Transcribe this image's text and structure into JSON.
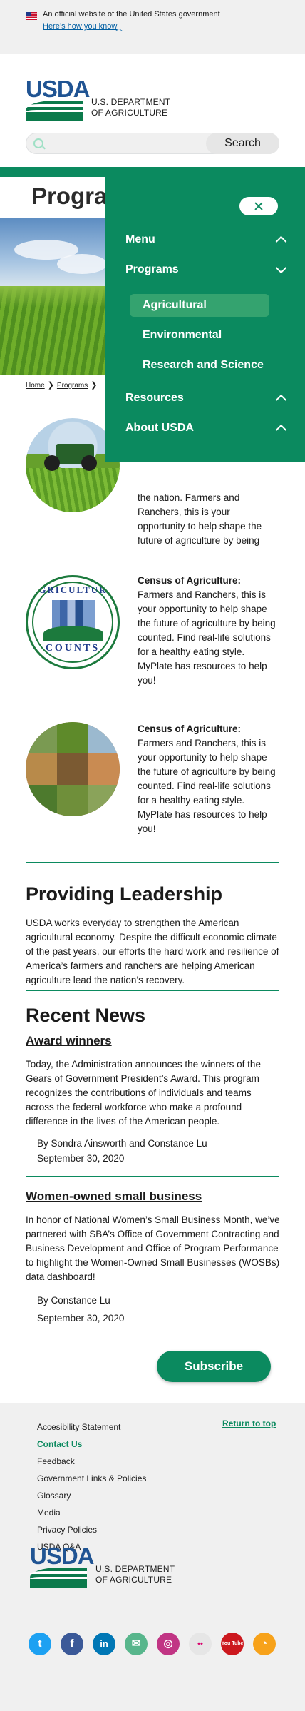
{
  "gov_banner": {
    "text": "An official website of the United States government",
    "link": "Here’s how you know"
  },
  "header": {
    "logo_usda": "USDA",
    "logo_line1": "U.S. DEPARTMENT",
    "logo_line2": "OF AGRICULTURE",
    "search_placeholder": "",
    "search_button": "Search"
  },
  "page": {
    "title": "Programs",
    "breadcrumb": [
      "Home",
      "Programs"
    ]
  },
  "cards": [
    {
      "title": "",
      "text": "the nation. Farmers and Ranchers, this is your opportunity to help shape the future of agriculture by being"
    },
    {
      "title": "Census of Agriculture:",
      "text": "Farmers and Ranchers, this is your opportunity to help shape the future of agriculture by being counted. Find real-life solutions for a healthy eating style. MyPlate has resources to help you!",
      "logo_top": "AGRICULTURE",
      "logo_bottom": "COUNTS"
    },
    {
      "title": "Census of Agriculture:",
      "text": "Farmers and Ranchers, this is your opportunity to help shape the future of agriculture by being counted. Find real-life solutions for a healthy eating style. MyPlate has resources to help you!"
    }
  ],
  "leadership": {
    "heading": "Providing Leadership",
    "body": "USDA works everyday to strengthen the American agricultural economy. Despite the difficult economic climate of the past years, our efforts the hard work and resilience of America’s farmers and ranchers are helping American agriculture lead the nation’s recovery."
  },
  "news": {
    "heading": "Recent News",
    "items": [
      {
        "title": "Award winners",
        "body": "Today, the Administration announces the winners of the Gears of Government President’s Award. This program recognizes the contributions of individuals and teams across the federal workforce who make a profound difference in the lives of the American people.",
        "author": "By Sondra Ainsworth and Constance Lu",
        "date": "September 30, 2020"
      },
      {
        "title": "Women-owned small business",
        "body": "In honor of National Women’s Small Business Month, we’ve partnered with SBA’s Office of Government Contracting and Business Development and Office of Program Performance to highlight the Women-Owned Small Businesses (WOSBs) data dashboard!",
        "author": "By Constance Lu",
        "date": "September 30, 2020"
      }
    ],
    "subscribe": "Subscribe"
  },
  "footer": {
    "links": [
      "Accesibility Statement",
      "Contact Us",
      "Feedback",
      "Government Links & Policies",
      "Glossary",
      "Media",
      "Privacy Policies",
      "USDA Q&A"
    ],
    "active_link": "Contact Us",
    "return_top": "Return to top",
    "socials": [
      {
        "name": "twitter-icon",
        "color": "#1da1f2",
        "glyph": "t"
      },
      {
        "name": "facebook-icon",
        "color": "#3b5998",
        "glyph": "f"
      },
      {
        "name": "linkedin-icon",
        "color": "#0077b5",
        "glyph": "in"
      },
      {
        "name": "email-icon",
        "color": "#58b68c",
        "glyph": "✉"
      },
      {
        "name": "instagram-icon",
        "color": "#c13584",
        "glyph": "◎"
      },
      {
        "name": "flickr-icon",
        "color": "#e6e6e6",
        "glyph": "••"
      },
      {
        "name": "youtube-icon",
        "color": "#cc181e",
        "glyph": "You Tube"
      },
      {
        "name": "rss-icon",
        "color": "#f7a21a",
        "glyph": "◔"
      }
    ]
  },
  "menu": {
    "items": [
      {
        "label": "Menu",
        "expanded": false
      },
      {
        "label": "Programs",
        "expanded": true
      },
      {
        "label": "Resources",
        "expanded": false
      },
      {
        "label": "About USDA",
        "expanded": false
      }
    ],
    "sub_items": [
      "Agricultural",
      "Environmental",
      "Research and Science"
    ],
    "active_sub": "Agricultural"
  },
  "colors": {
    "brand_green": "#0b8a5f",
    "usda_blue": "#205493",
    "active_sub_bg": "#34a36f"
  }
}
